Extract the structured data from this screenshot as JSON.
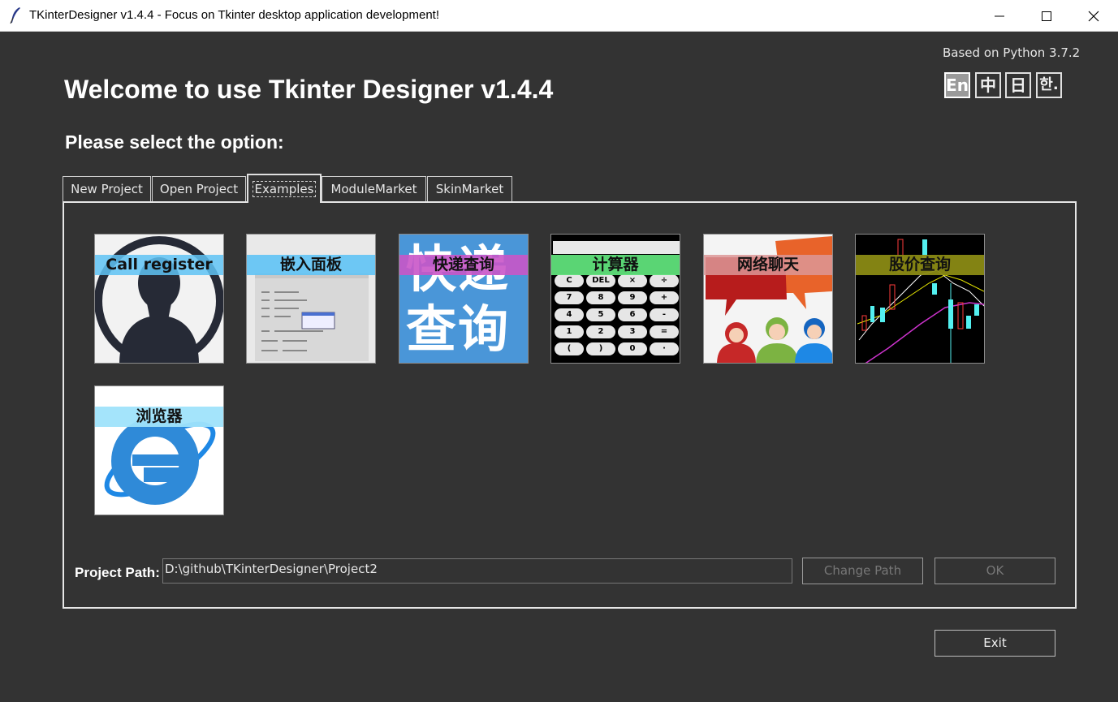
{
  "window": {
    "title": "TKinterDesigner v1.4.4 - Focus on Tkinter desktop application development!"
  },
  "header": {
    "python_version": "Based on Python 3.7.2",
    "welcome": "Welcome to use Tkinter Designer v1.4.4",
    "prompt": "Please select the option:"
  },
  "languages": [
    {
      "label": "En",
      "active": true
    },
    {
      "label": "中",
      "active": false
    },
    {
      "label": "日",
      "active": false
    },
    {
      "label": "한.",
      "active": false
    }
  ],
  "tabs": [
    {
      "label": "New Project"
    },
    {
      "label": "Open Project"
    },
    {
      "label": "Examples",
      "active": true
    },
    {
      "label": "ModuleMarket"
    },
    {
      "label": "SkinMarket"
    }
  ],
  "examples": [
    {
      "label": "Call register",
      "icon": "person-icon",
      "band_color": "#5fc3f5"
    },
    {
      "label": "嵌入面板",
      "icon": "embedded-panel-icon",
      "band_color": "#5fc3f5"
    },
    {
      "label": "快递查询",
      "icon": "express-query-icon",
      "band_color": "#c955c8"
    },
    {
      "label": "计算器",
      "icon": "calculator-icon",
      "band_color": "#5fe07a"
    },
    {
      "label": "网络聊天",
      "icon": "chat-icon",
      "band_color": "#d9a0a0"
    },
    {
      "label": "股价查询",
      "icon": "stock-chart-icon",
      "band_color": "#8a8a14"
    },
    {
      "label": "浏览器",
      "icon": "browser-icon",
      "band_color": "#9fe3fb"
    }
  ],
  "calculator_keys": [
    "C",
    "DEL",
    "×",
    "÷",
    "7",
    "8",
    "9",
    "+",
    "4",
    "5",
    "6",
    "-",
    "1",
    "2",
    "3",
    "=",
    "(",
    ")",
    "0",
    "·"
  ],
  "express_chars": [
    "快",
    "递",
    "查",
    "询"
  ],
  "form": {
    "path_label": "Project Path:",
    "path_value": "D:\\github\\TKinterDesigner\\Project2",
    "change_path": "Change Path",
    "ok": "OK",
    "exit": "Exit"
  },
  "colors": {
    "background": "#333333",
    "text": "#ffffff",
    "disabled_text": "#777777"
  }
}
